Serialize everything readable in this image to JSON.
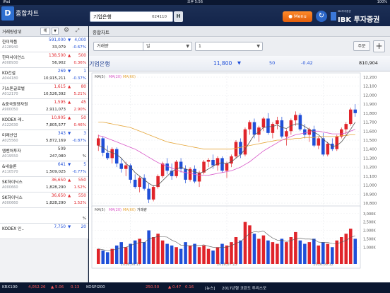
{
  "statusbar": {
    "carrier": "iPad",
    "time": "오후 5:56",
    "battery": "100%"
  },
  "header": {
    "screen_title": "종합차트",
    "search_name": "기업은행",
    "search_code": "024110",
    "h_button": "H",
    "menu_button": "● Menu",
    "brand_small": "IBK투자증권",
    "brand_big": "IBK 투자증권"
  },
  "left_panel": {
    "sort_label": "거래량상위",
    "sort_select": "예",
    "stocks": [
      {
        "name": "한미약품",
        "code": "A128940",
        "price": "591,000",
        "dir": "down",
        "change": "4,000",
        "volume": "33,079",
        "rate": "-0.67%"
      },
      {
        "name": "한미사이언스",
        "code": "A008930",
        "price": "138,500",
        "dir": "up",
        "change": "500",
        "volume": "56,902",
        "rate": "0.36%"
      },
      {
        "name": "KD건설",
        "code": "A044180",
        "price": "269",
        "dir": "down",
        "change": "1",
        "volume": "10,915,211",
        "rate": "-0.37%"
      },
      {
        "name": "키스톤글로벌",
        "code": "A012170",
        "price": "1,615",
        "dir": "up",
        "change": "80",
        "volume": "10,526,392",
        "rate": "5.21%"
      },
      {
        "name": "&중국원양자원",
        "code": "A900050",
        "price": "1,595",
        "dir": "up",
        "change": "45",
        "volume": "2,911,073",
        "rate": "2.90%"
      },
      {
        "name": "KODEX 레..",
        "code": "A122630",
        "price": "10,905",
        "dir": "up",
        "change": "50",
        "volume": "7,805,577",
        "rate": "0.46%"
      },
      {
        "name": "미래산업",
        "code": "A025560",
        "price": "343",
        "dir": "down",
        "change": "3",
        "volume": "5,872,169",
        "rate": "-0.87%"
      },
      {
        "name": "엠벤처투자",
        "code": "A019550",
        "price": "509",
        "dir": "neutral",
        "change": "",
        "volume": "247,080",
        "rate": "%"
      },
      {
        "name": "&네솔론",
        "code": "A110570",
        "price": "641",
        "dir": "down",
        "change": "5",
        "volume": "1,509,025",
        "rate": "-0.77%"
      },
      {
        "name": "SK하이닉스",
        "code": "A000660",
        "price": "36,650",
        "dir": "up",
        "change": "550",
        "volume": "1,828,290",
        "rate": "1.52%"
      },
      {
        "name": "SK하이닉스",
        "code": "A000660",
        "price": "36,650",
        "dir": "up",
        "change": "550",
        "volume": "1,828,290",
        "rate": "1.52%"
      },
      {
        "name": "",
        "code": "",
        "price": "",
        "dir": "neutral",
        "change": "",
        "volume": "",
        "rate": "%"
      },
      {
        "name": "KODEX 인..",
        "code": "",
        "price": "7,750",
        "dir": "down",
        "change": "20",
        "volume": "",
        "rate": ""
      }
    ]
  },
  "chart_panel": {
    "title": "종합차트",
    "type_select": "거래량",
    "period_select": "일",
    "count_select": "1",
    "order_button": "주문",
    "plus_button": "+",
    "stock_name": "기업은행",
    "price": "11,800",
    "change_arrow": "▼",
    "change": "50",
    "rate": "-0.42",
    "volume": "810,904"
  },
  "chart_data": {
    "type": "candlestick",
    "price_legend": [
      "MA(5)",
      "MA(20)",
      "MA(60)"
    ],
    "volume_legend": [
      "MA(5)",
      "MA(20)",
      "MA(60)",
      "거래량"
    ],
    "price_axis_ticks": [
      "12,200",
      "12,100",
      "12,000",
      "11,900",
      "11,800",
      "11,700",
      "11,600",
      "11,500",
      "11,400",
      "11,300",
      "11,200",
      "11,100",
      "11,000",
      "10,900",
      "10,800"
    ],
    "price_ylim": [
      10800,
      12200
    ],
    "volume_axis_ticks": [
      "3,000K",
      "2,500K",
      "2,000K",
      "1,500K",
      "1,000K"
    ],
    "volume_ylim": [
      0,
      3200
    ],
    "date_labels": [
      "2016.06.17",
      "2016.07.15",
      "2016.08.12"
    ],
    "candles": [
      [
        11440,
        11560,
        11380,
        11520
      ],
      [
        11520,
        11540,
        11320,
        11360
      ],
      [
        11360,
        11440,
        11280,
        11300
      ],
      [
        11300,
        11420,
        11240,
        11400
      ],
      [
        11400,
        11420,
        11200,
        11240
      ],
      [
        11240,
        11300,
        11140,
        11180
      ],
      [
        11180,
        11260,
        11100,
        11220
      ],
      [
        11220,
        11240,
        11020,
        11060
      ],
      [
        11060,
        11120,
        10960,
        10980
      ],
      [
        10980,
        11100,
        10920,
        11080
      ],
      [
        11080,
        11120,
        10940,
        10960
      ],
      [
        10960,
        11020,
        10800,
        10840
      ],
      [
        10840,
        11000,
        10820,
        10980
      ],
      [
        10980,
        11120,
        10960,
        11100
      ],
      [
        11100,
        11260,
        11080,
        11240
      ],
      [
        11240,
        11300,
        11120,
        11160
      ],
      [
        11160,
        11240,
        11060,
        11100
      ],
      [
        11100,
        11280,
        11080,
        11260
      ],
      [
        11260,
        11300,
        11140,
        11180
      ],
      [
        11180,
        11220,
        11020,
        11060
      ],
      [
        11060,
        11200,
        11040,
        11180
      ],
      [
        11180,
        11220,
        11020,
        11040
      ],
      [
        11040,
        11160,
        10980,
        11140
      ],
      [
        11140,
        11280,
        11120,
        11260
      ],
      [
        11260,
        11300,
        11200,
        11280
      ],
      [
        11280,
        11340,
        11180,
        11220
      ],
      [
        11220,
        11320,
        11160,
        11300
      ],
      [
        11300,
        11320,
        11140,
        11160
      ],
      [
        11160,
        11260,
        11080,
        11240
      ],
      [
        11240,
        11340,
        11200,
        11320
      ],
      [
        11320,
        11500,
        11300,
        11480
      ],
      [
        11480,
        11520,
        11300,
        11340
      ],
      [
        11340,
        11640,
        11320,
        11620
      ],
      [
        11620,
        11720,
        11560,
        11700
      ],
      [
        11700,
        11740,
        11520,
        11560
      ],
      [
        11560,
        11660,
        11480,
        11640
      ],
      [
        11640,
        11760,
        11600,
        11740
      ],
      [
        11740,
        11800,
        11560,
        11580
      ],
      [
        11580,
        11700,
        11520,
        11680
      ],
      [
        11680,
        11760,
        11620,
        11720
      ],
      [
        11720,
        11760,
        11520,
        11540
      ],
      [
        11540,
        11620,
        11440,
        11600
      ],
      [
        11600,
        11740,
        11560,
        11720
      ],
      [
        11720,
        11820,
        11660,
        11780
      ],
      [
        11780,
        11800,
        11600,
        11620
      ],
      [
        11620,
        11680,
        11520,
        11560
      ],
      [
        11560,
        11640,
        11480,
        11620
      ],
      [
        11620,
        11660,
        11420,
        11440
      ],
      [
        11440,
        11540,
        11400,
        11520
      ],
      [
        11520,
        11580,
        11320,
        11340
      ],
      [
        11340,
        11480,
        11320,
        11460
      ],
      [
        11460,
        11520,
        11380,
        11400
      ],
      [
        11400,
        11560,
        11380,
        11540
      ],
      [
        11540,
        11640,
        11520,
        11620
      ],
      [
        11620,
        11700,
        11560,
        11680
      ],
      [
        11680,
        11860,
        11660,
        11840
      ],
      [
        11840,
        11900,
        11760,
        11800
      ]
    ],
    "volumes": [
      900,
      800,
      700,
      900,
      1100,
      1300,
      1000,
      1200,
      1400,
      1500,
      1300,
      2000,
      1600,
      1800,
      1400,
      1200,
      1100,
      1000,
      900,
      1300,
      1100,
      1200,
      1000,
      1100,
      900,
      800,
      1000,
      1200,
      1100,
      1300,
      1600,
      1400,
      2500,
      2300,
      1800,
      1500,
      1700,
      1400,
      1300,
      1200,
      1500,
      1300,
      1600,
      1900,
      1400,
      1200,
      1300,
      1500,
      1100,
      1300,
      1200,
      1000,
      1400,
      1600,
      1800,
      2100,
      1500
    ],
    "ma5": [
      11440,
      11420,
      11380,
      11360,
      11340,
      11300,
      11240,
      11200,
      11140,
      11100,
      11060,
      11020,
      10990,
      11000,
      11050,
      11100,
      11150,
      11180,
      11200,
      11180,
      11160,
      11150,
      11130,
      11150,
      11180,
      11210,
      11240,
      11250,
      11240,
      11260,
      11300,
      11340,
      11400,
      11480,
      11560,
      11590,
      11640,
      11650,
      11650,
      11670,
      11640,
      11630,
      11660,
      11680,
      11680,
      11650,
      11620,
      11590,
      11560,
      11510,
      11470,
      11430,
      11440,
      11480,
      11550,
      11620,
      11700
    ],
    "ma20": [
      11550,
      11540,
      11520,
      11500,
      11480,
      11460,
      11440,
      11420,
      11400,
      11370,
      11340,
      11310,
      11280,
      11250,
      11230,
      11210,
      11190,
      11170,
      11150,
      11140,
      11130,
      11120,
      11110,
      11110,
      11110,
      11120,
      11130,
      11140,
      11150,
      11160,
      11180,
      11200,
      11230,
      11260,
      11300,
      11340,
      11380,
      11410,
      11440,
      11470,
      11500,
      11520,
      11540,
      11560,
      11570,
      11580,
      11590,
      11600,
      11600,
      11590,
      11580,
      11570,
      11570,
      11570,
      11580,
      11600,
      11620
    ],
    "ma60": [
      11700,
      11700,
      11690,
      11680,
      11670,
      11660,
      11650,
      11640,
      11620,
      11600,
      11580,
      11560,
      11540,
      11520,
      11500,
      11480,
      11470,
      11460,
      11450,
      11440,
      11430,
      11420,
      11410,
      11400,
      11400,
      11400,
      11400,
      11400,
      11400,
      11400,
      11410,
      11420,
      11430,
      11440,
      11450,
      11460,
      11470,
      11480,
      11490,
      11500,
      11500,
      11510,
      11510,
      11520,
      11520,
      11530,
      11530,
      11530,
      11540,
      11540,
      11540,
      11540,
      11540,
      11550,
      11550,
      11560,
      11560
    ]
  },
  "ticker": {
    "idx1_name": "KRX100",
    "idx1_value": "4,052.26",
    "idx1_change": "▲ 5.06",
    "idx1_rate": "0.13",
    "idx2_name": "KOSPI200",
    "idx2_value": "250.50",
    "idx2_change": "▲ 0.47",
    "idx2_rate": "0.16",
    "news_label": "[뉴스]",
    "news_text": "2017년형 코란도 투리스모"
  },
  "colors": {
    "up": "#e0242a",
    "down": "#1f4fd8",
    "header_bg": "#13244a",
    "menu_orange": "#f07a1b"
  }
}
